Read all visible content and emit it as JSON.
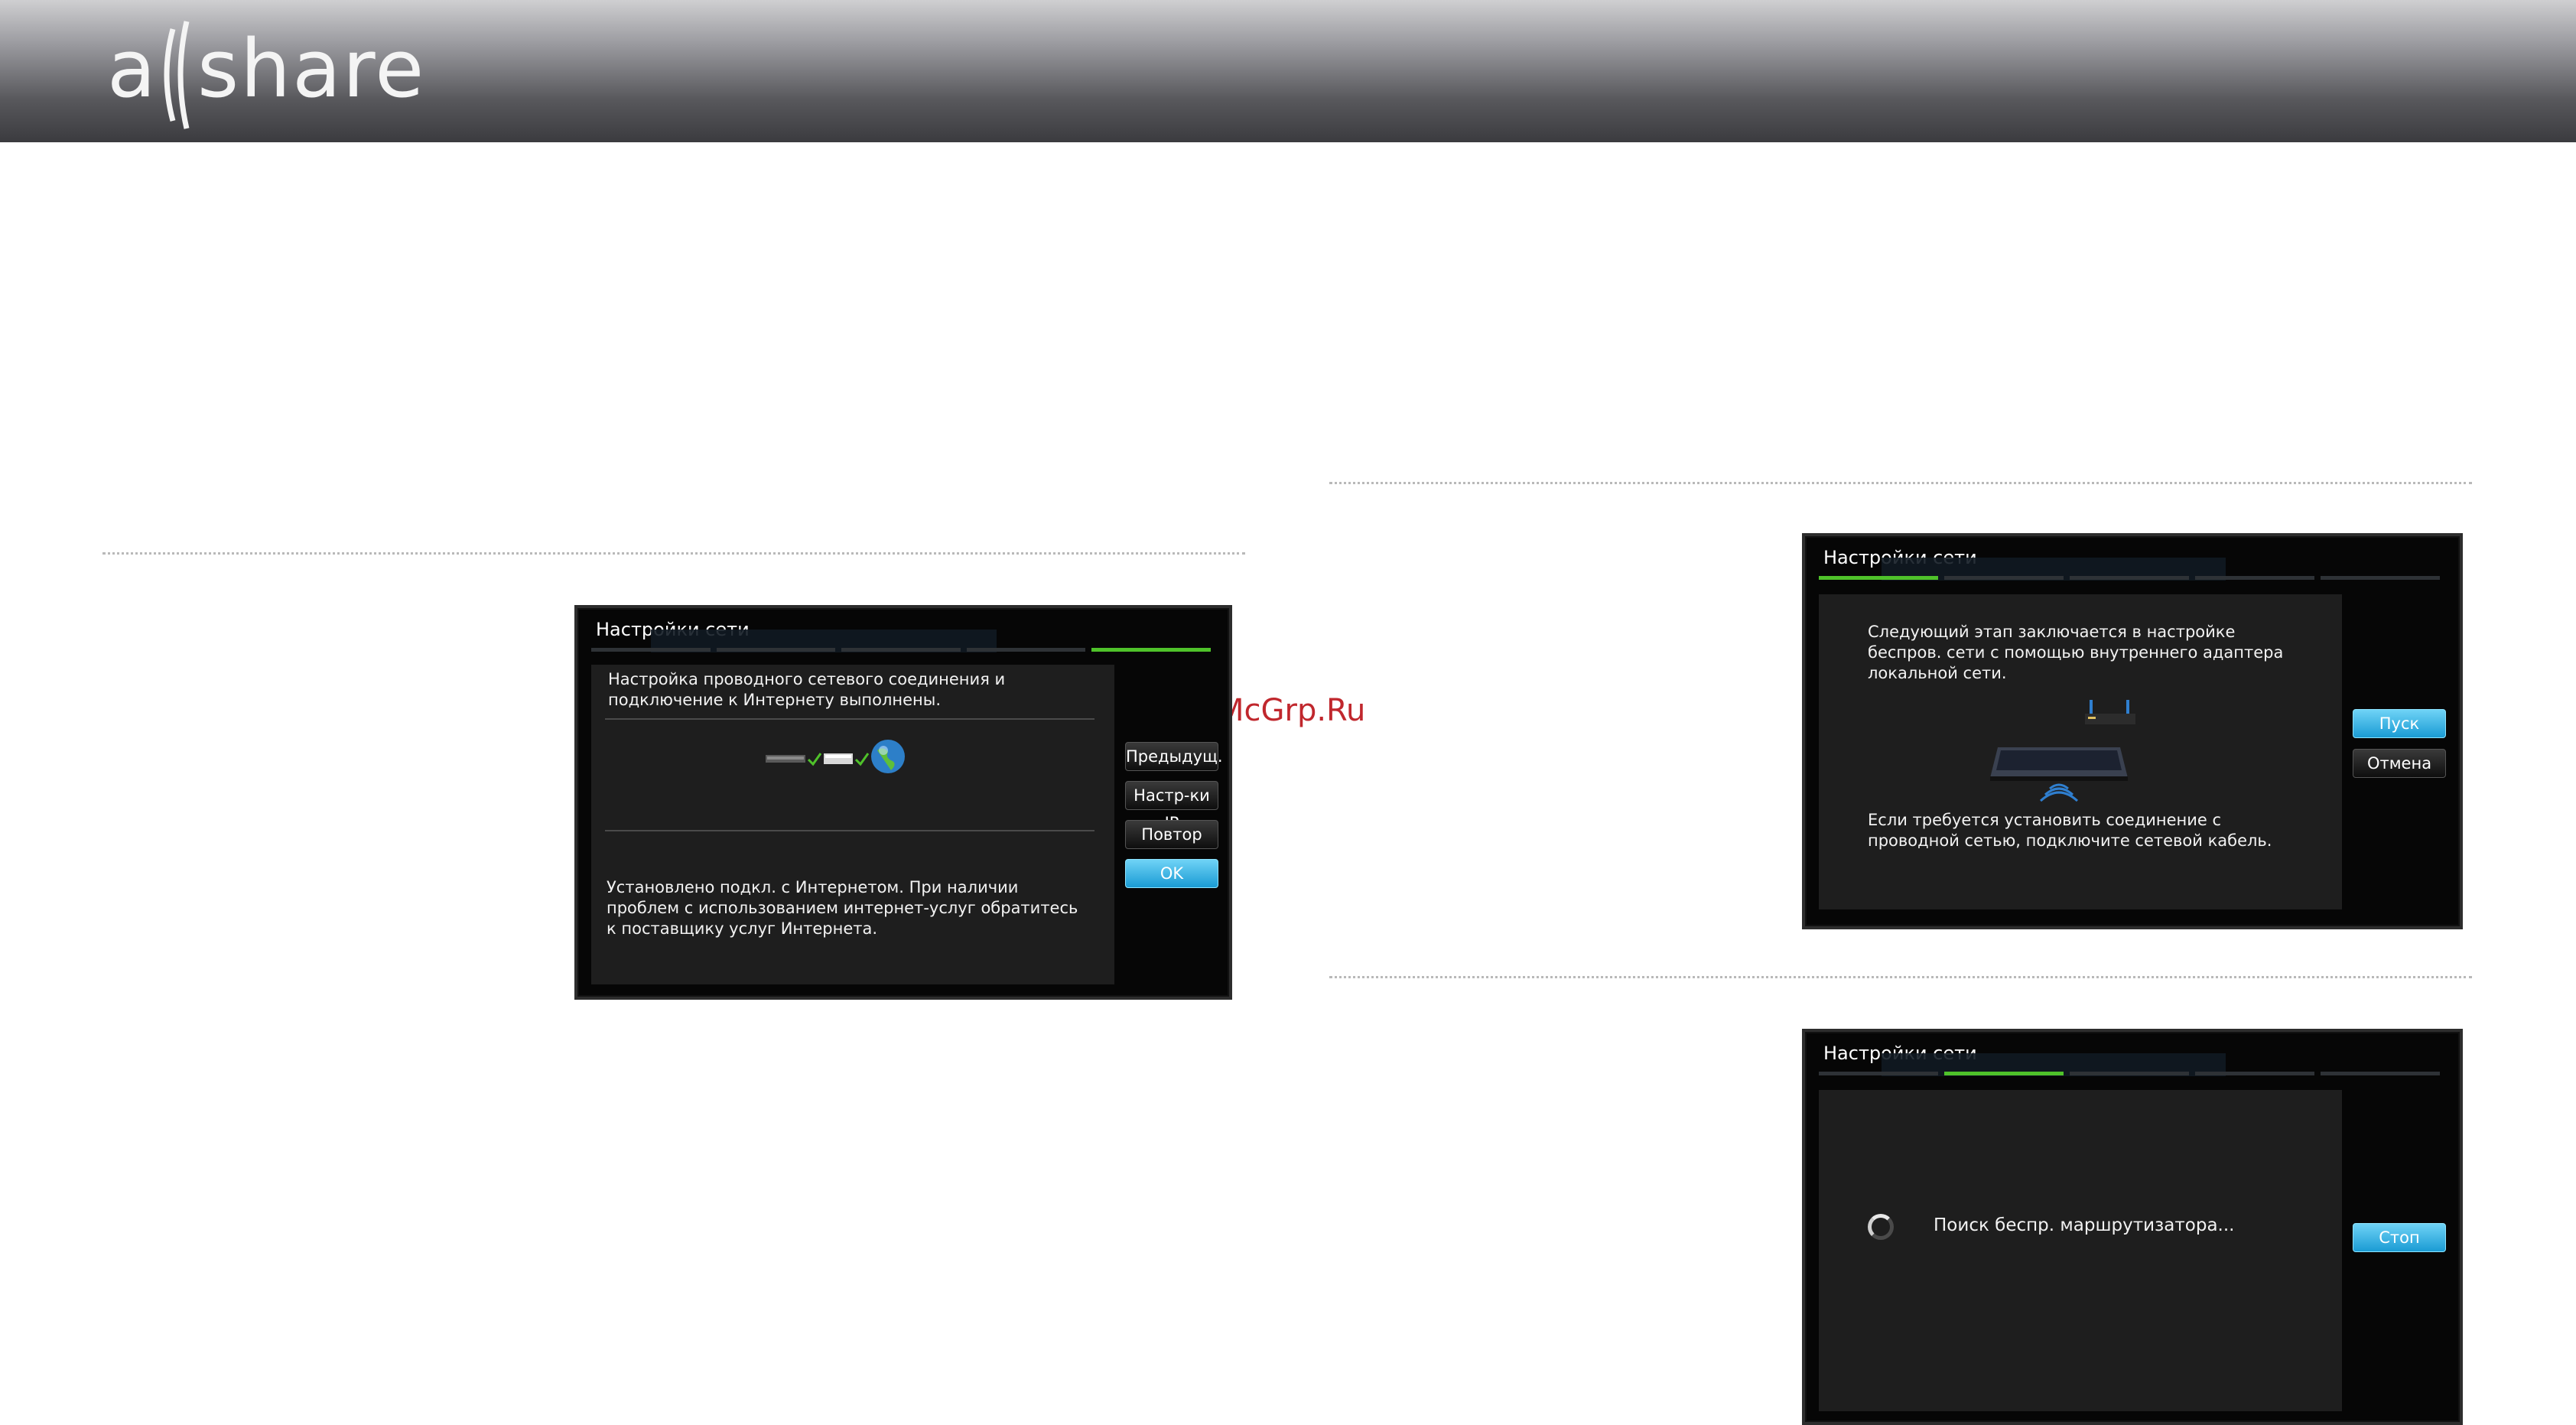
{
  "header": {
    "logo_text": "allshare"
  },
  "watermark": "McGrp.Ru",
  "screens": {
    "wired_done": {
      "title": "Настройки сети",
      "message_top": "Настройка проводного сетевого соединения и подключение к Интернету выполнены.",
      "message_bottom": "Установлено подкл. с Интернетом. При наличии проблем с использованием интернет-услуг обратитесь к поставщику услуг Интернета.",
      "buttons": [
        "Предыдущ.",
        "Настр-ки IP",
        "Повтор",
        "OK"
      ]
    },
    "wireless_intro": {
      "title": "Настройки сети",
      "message_top": "Следующий этап заключается в настройке беспров. сети с помощью внутреннего адаптера локальной сети.",
      "message_bottom": "Если требуется установить соединение с проводной сетью, подключите сетевой кабель.",
      "buttons": [
        "Пуск",
        "Отмена"
      ]
    },
    "searching": {
      "title": "Настройки сети",
      "status": "Поиск беспр. маршрутизатора...",
      "buttons": [
        "Стоп"
      ]
    }
  },
  "colors": {
    "accent_green": "#4fc22a",
    "button_blue": "#1a9bd4",
    "watermark_red": "#c0272d"
  }
}
